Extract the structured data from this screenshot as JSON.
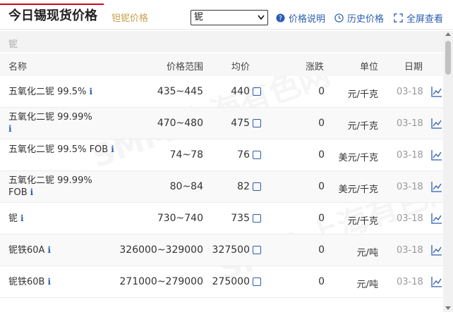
{
  "header": {
    "title": "今日锡现货价格",
    "subtab": "钽铌价格",
    "select_value": "铌",
    "tools": [
      {
        "label": "价格说明",
        "icon": "question-circle-icon"
      },
      {
        "label": "历史价格",
        "icon": "clock-icon"
      },
      {
        "label": "全屏查看",
        "icon": "fullscreen-icon"
      }
    ]
  },
  "section": {
    "label": "铌"
  },
  "columns": [
    "名称",
    "价格范围",
    "均价",
    "涨跌",
    "单位",
    "日期"
  ],
  "rows": [
    {
      "name": "五氧化二铌 99.5%",
      "range": "435~445",
      "avg": "440",
      "change": "0",
      "unit": "元/千克",
      "date": "03-18"
    },
    {
      "name": "五氧化二铌 99.99%",
      "range": "470~480",
      "avg": "475",
      "change": "0",
      "unit": "元/千克",
      "date": "03-18"
    },
    {
      "name": "五氧化二铌 99.5% FOB",
      "range": "74~78",
      "avg": "76",
      "change": "0",
      "unit": "美元/千克",
      "date": "03-18"
    },
    {
      "name": "五氧化二铌 99.99% FOB",
      "range": "80~84",
      "avg": "82",
      "change": "0",
      "unit": "美元/千克",
      "date": "03-18"
    },
    {
      "name": "铌",
      "range": "730~740",
      "avg": "735",
      "change": "0",
      "unit": "元/千克",
      "date": "03-18"
    },
    {
      "name": "铌铁60A",
      "range": "326000~329000",
      "avg": "327500",
      "change": "0",
      "unit": "元/吨",
      "date": "03-18"
    },
    {
      "name": "铌铁60B",
      "range": "271000~279000",
      "avg": "275000",
      "change": "0",
      "unit": "元/吨",
      "date": "03-18"
    }
  ],
  "info_glyph": "i",
  "watermark": "SMM 上海有色网",
  "colors": {
    "accent_red": "#d0021b",
    "link_blue": "#2a5db0",
    "gold": "#c8a04a"
  }
}
